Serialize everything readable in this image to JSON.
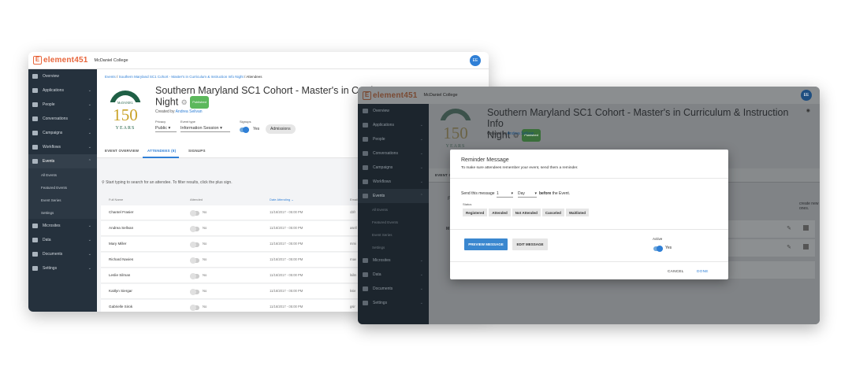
{
  "app": {
    "logo_text": "element451",
    "logo_mark": "E",
    "org": "McDaniel College",
    "avatar_initials": "EE"
  },
  "sidebar": {
    "items": [
      {
        "label": "Overview",
        "icon": "grid-icon"
      },
      {
        "label": "Applications",
        "icon": "file-icon"
      },
      {
        "label": "People",
        "icon": "people-icon"
      },
      {
        "label": "Conversations",
        "icon": "chat-icon"
      },
      {
        "label": "Campaigns",
        "icon": "megaphone-icon"
      },
      {
        "label": "Workflows",
        "icon": "workflow-icon"
      },
      {
        "label": "Events",
        "icon": "calendar-icon"
      },
      {
        "label": "Microsites",
        "icon": "cloud-icon"
      },
      {
        "label": "Data",
        "icon": "data-icon"
      },
      {
        "label": "Documents",
        "icon": "folder-icon"
      },
      {
        "label": "Settings",
        "icon": "settings-icon"
      }
    ],
    "events_sub": [
      "All Events",
      "Featured Events",
      "Event Series",
      "Settings"
    ]
  },
  "breadcrumb": {
    "root": "Events",
    "sep1": "/",
    "parent": "Southern Maryland SC1 Cohort - Master's in Curriculum & Instruction Info Night",
    "sep2": "/",
    "current": "Attendees"
  },
  "seal": {
    "top": "McDANIEL",
    "big": "150",
    "bottom": "YEARS"
  },
  "event": {
    "title_w1": "Southern Maryland SC1 Cohort - Master's in Curricu",
    "title_w1_line2": "Night",
    "title_w2": "Southern Maryland SC1 Cohort - Master's in Curriculum & Instruction Info",
    "title_w2_line2": "Night",
    "status": "Published",
    "created_prefix": "Created by",
    "created_by": "Andrea Sellvan",
    "privacy_label": "Privacy",
    "privacy_value": "Public",
    "type_label": "Event type",
    "type_value": "Information Session",
    "signups_label": "Signups",
    "signups_value": "Yes",
    "admissions_btn": "Admissions"
  },
  "tabs": [
    "EVENT OVERVIEW",
    "ATTENDEES (8)",
    "SIGNUPS"
  ],
  "attendees": {
    "search_placeholder": "Start typing to search for an attendee. To filter results, click the plus sign.",
    "headers": {
      "name": "Full Name",
      "attended": "Attended",
      "date": "Date Attending",
      "email": "Email"
    },
    "attended_no": "No",
    "rows": [
      {
        "name": "Chantel Frasier",
        "date": "11/16/2017 - 05:00 PM",
        "email": "cbfr"
      },
      {
        "name": "Andrea Sellvan",
        "date": "11/16/2017 - 05:00 PM",
        "email": "asell"
      },
      {
        "name": "Mary Miller",
        "date": "11/16/2017 - 05:00 PM",
        "email": "mmi"
      },
      {
        "name": "Richard Navies",
        "date": "11/16/2017 - 05:00 PM",
        "email": "rnav"
      },
      {
        "name": "Leslie Silman",
        "date": "11/16/2017 - 05:00 PM",
        "email": "lsilm"
      },
      {
        "name": "Kaitlyn Siergar",
        "date": "11/16/2017 - 05:00 PM",
        "email": "ksie"
      },
      {
        "name": "Gabrielle Sirok",
        "date": "11/16/2017 - 05:00 PM",
        "email": "gsir"
      }
    ]
  },
  "window2": {
    "tab_partial": "EVENT O",
    "hint_partial": "create new ones.",
    "label_f": "F",
    "label_m": "M"
  },
  "modal": {
    "title": "Reminder Message",
    "subtitle": "To make sure attendees remember your event, send them a reminder.",
    "send_label": "Send this message",
    "amount": "1",
    "unit": "Day",
    "before": "before",
    "the_event": "the Event.",
    "status_label": "Status",
    "statuses": [
      "Registered",
      "Attended",
      "Not Attended",
      "Canceled",
      "Waitlisted"
    ],
    "preview_btn": "PREVIEW MESSAGE",
    "edit_btn": "EDIT MESSAGE",
    "active_label": "Active",
    "active_value": "Yes",
    "cancel": "CANCEL",
    "done": "DONE"
  },
  "colors": {
    "accent": "#2f7fd6",
    "sidebar": "#25313d",
    "brand": "#e8663c",
    "seal_green": "#1f5f45",
    "badge": "#5cb85c"
  }
}
